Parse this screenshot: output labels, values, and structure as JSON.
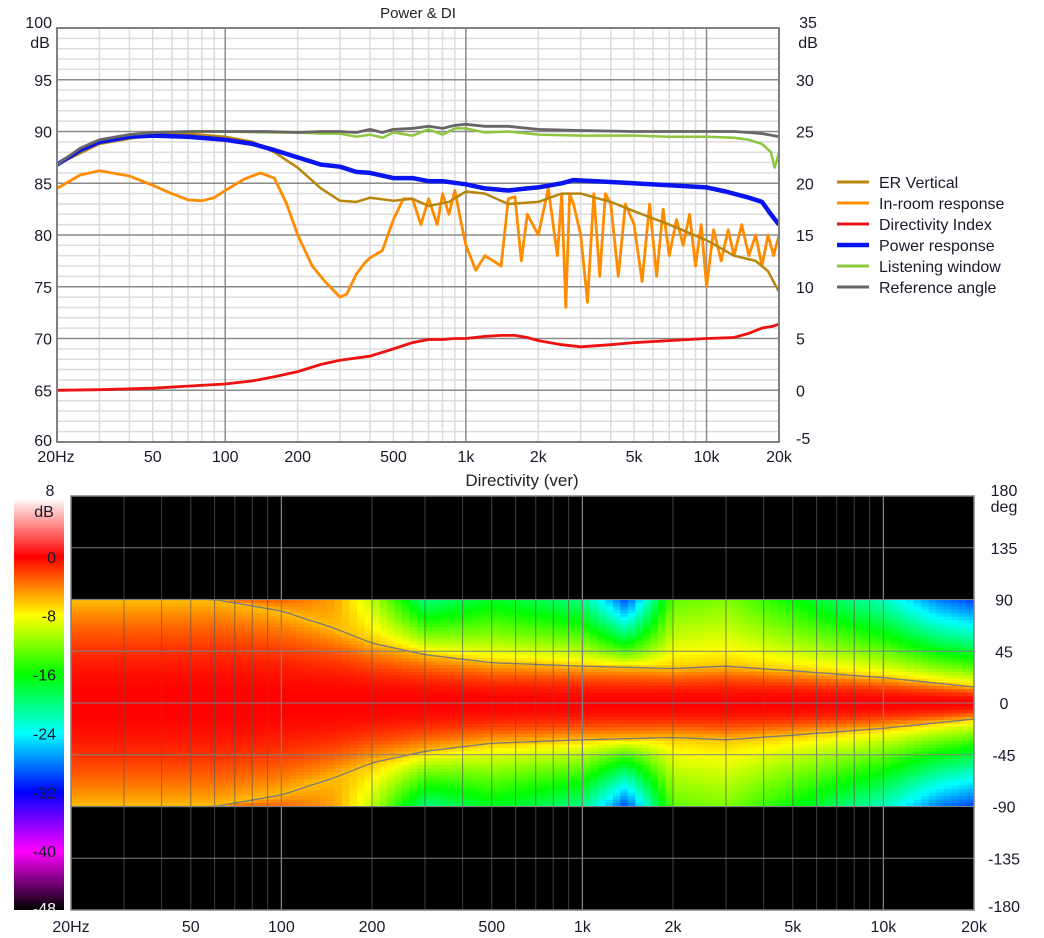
{
  "chart_data": [
    {
      "type": "line",
      "title": "Power & DI",
      "xlabel": "",
      "x_scale": "log",
      "xlim": [
        20,
        20000
      ],
      "x_ticks": [
        {
          "value": 20,
          "label": "20Hz"
        },
        {
          "value": 50,
          "label": "50"
        },
        {
          "value": 100,
          "label": "100"
        },
        {
          "value": 200,
          "label": "200"
        },
        {
          "value": 500,
          "label": "500"
        },
        {
          "value": 1000,
          "label": "1k"
        },
        {
          "value": 2000,
          "label": "2k"
        },
        {
          "value": 5000,
          "label": "5k"
        },
        {
          "value": 10000,
          "label": "10k"
        },
        {
          "value": 20000,
          "label": "20k"
        }
      ],
      "ylabel_left_unit": "dB",
      "ylim_left": [
        60,
        100
      ],
      "y_ticks_left": [
        60,
        65,
        70,
        75,
        80,
        85,
        90,
        95,
        100
      ],
      "ylabel_right_unit": "dB",
      "ylim_right": [
        -5,
        35
      ],
      "y_ticks_right": [
        -5,
        0,
        5,
        10,
        15,
        20,
        25,
        30,
        35
      ],
      "grid": true,
      "legend_position": "right",
      "series": [
        {
          "name": "ER Vertical",
          "color": "#b8860b",
          "axis": "left",
          "x": [
            20,
            30,
            50,
            70,
            100,
            130,
            160,
            200,
            250,
            300,
            350,
            400,
            500,
            600,
            700,
            850,
            1000,
            1200,
            1500,
            2000,
            2500,
            3000,
            4000,
            5000,
            7000,
            10000,
            13000,
            16000,
            18000,
            20000
          ],
          "y": [
            86.8,
            88.8,
            89.7,
            89.8,
            89.5,
            89,
            88,
            86.5,
            84.5,
            83.3,
            83.2,
            83.6,
            83.3,
            83.5,
            82.8,
            83.2,
            84.2,
            84,
            83,
            83.2,
            84,
            84,
            83.2,
            82.3,
            81,
            79.5,
            78,
            77.5,
            76.5,
            74.5
          ]
        },
        {
          "name": "In-room response",
          "color": "#ff8c00",
          "axis": "left",
          "x": [
            20,
            25,
            30,
            40,
            50,
            60,
            70,
            80,
            90,
            100,
            120,
            140,
            160,
            180,
            200,
            230,
            260,
            300,
            320,
            350,
            380,
            400,
            450,
            500,
            550,
            600,
            650,
            700,
            760,
            800,
            850,
            900,
            950,
            1000,
            1100,
            1200,
            1300,
            1400,
            1500,
            1600,
            1700,
            1800,
            2000,
            2200,
            2400,
            2500,
            2600,
            2700,
            2800,
            3000,
            3200,
            3400,
            3600,
            3800,
            4000,
            4300,
            4600,
            5000,
            5400,
            5800,
            6200,
            6600,
            7000,
            7500,
            8000,
            8500,
            9000,
            9500,
            10000,
            10700,
            11500,
            12300,
            13000,
            14000,
            15000,
            16000,
            17000,
            18000,
            19000,
            20000
          ],
          "y": [
            84.5,
            85.8,
            86.2,
            85.7,
            84.8,
            84,
            83.4,
            83.3,
            83.6,
            84.3,
            85.4,
            86,
            85.5,
            83,
            80,
            77,
            75.5,
            74,
            74.3,
            76.2,
            77.3,
            77.8,
            78.5,
            81.5,
            83.5,
            83.5,
            81,
            83.5,
            81,
            84,
            82,
            84.3,
            81.5,
            79,
            76.6,
            78,
            77.5,
            77,
            83.5,
            83.7,
            77.5,
            82,
            80,
            84.5,
            78,
            84,
            73,
            84,
            83,
            80,
            73.5,
            84,
            76,
            84,
            83,
            76,
            83,
            81,
            75.5,
            83,
            76,
            82.5,
            78,
            81.5,
            79,
            82,
            77,
            81,
            75,
            80.5,
            77.5,
            80.5,
            78,
            81,
            78,
            80,
            77,
            80,
            78,
            80
          ]
        },
        {
          "name": "Directivity Index",
          "color": "#ee1111",
          "axis": "right",
          "x": [
            20,
            30,
            50,
            70,
            100,
            130,
            160,
            200,
            250,
            300,
            400,
            500,
            600,
            700,
            800,
            900,
            1000,
            1200,
            1400,
            1600,
            1800,
            2000,
            2500,
            3000,
            4000,
            5000,
            7000,
            10000,
            13000,
            15000,
            17000,
            19000,
            20000
          ],
          "y": [
            0,
            0.05,
            0.2,
            0.4,
            0.6,
            0.9,
            1.3,
            1.8,
            2.5,
            2.9,
            3.3,
            4,
            4.6,
            4.9,
            4.9,
            5,
            5,
            5.2,
            5.3,
            5.3,
            5.1,
            4.8,
            4.4,
            4.2,
            4.4,
            4.6,
            4.8,
            5,
            5.1,
            5.5,
            6,
            6.2,
            6.4
          ]
        },
        {
          "name": "Power response",
          "color": "#0a14f0",
          "axis": "left",
          "x": [
            20,
            25,
            30,
            40,
            50,
            70,
            100,
            130,
            160,
            200,
            250,
            300,
            350,
            400,
            500,
            600,
            700,
            800,
            1000,
            1200,
            1500,
            1800,
            2000,
            2500,
            2800,
            3500,
            5000,
            7000,
            10000,
            12000,
            15000,
            17000,
            18500,
            20000
          ],
          "y": [
            86.8,
            88.2,
            89,
            89.5,
            89.6,
            89.5,
            89.2,
            88.8,
            88.2,
            87.5,
            86.8,
            86.6,
            86.1,
            86,
            85.5,
            85.5,
            85.2,
            85.2,
            84.9,
            84.5,
            84.3,
            84.5,
            84.6,
            85,
            85.3,
            85.2,
            85,
            84.8,
            84.6,
            84.2,
            83.6,
            83.2,
            82,
            81
          ]
        },
        {
          "name": "Listening window",
          "color": "#8dc63f",
          "axis": "left",
          "x": [
            20,
            25,
            30,
            40,
            50,
            70,
            100,
            150,
            200,
            250,
            300,
            350,
            400,
            450,
            500,
            600,
            700,
            800,
            900,
            1000,
            1200,
            1500,
            2000,
            3000,
            5000,
            7000,
            10000,
            13000,
            15000,
            17000,
            18500,
            19200,
            20000
          ],
          "y": [
            86.8,
            88.4,
            89.2,
            89.7,
            89.9,
            90,
            90,
            89.9,
            89.9,
            89.8,
            89.8,
            89.5,
            89.7,
            89.4,
            89.9,
            89.6,
            90.2,
            89.7,
            90.3,
            90.3,
            89.9,
            90,
            89.7,
            89.6,
            89.6,
            89.5,
            89.5,
            89.4,
            89.2,
            88.8,
            88,
            86.5,
            88
          ]
        },
        {
          "name": "Reference angle",
          "color": "#666666",
          "axis": "left",
          "x": [
            20,
            25,
            30,
            40,
            50,
            70,
            100,
            150,
            200,
            250,
            300,
            350,
            400,
            450,
            500,
            600,
            700,
            800,
            900,
            1000,
            1200,
            1500,
            2000,
            3000,
            5000,
            7000,
            10000,
            13000,
            15000,
            17000,
            19000,
            20000
          ],
          "y": [
            86.8,
            88.4,
            89.2,
            89.7,
            89.9,
            90,
            90,
            90,
            89.9,
            90,
            90,
            89.9,
            90.2,
            89.9,
            90.2,
            90.3,
            90.5,
            90.3,
            90.6,
            90.7,
            90.5,
            90.5,
            90.2,
            90.1,
            90,
            90,
            90,
            90,
            89.9,
            89.8,
            89.6,
            89.5
          ]
        }
      ]
    },
    {
      "type": "heatmap",
      "title": "Directivity (ver)",
      "x_scale": "log",
      "xlim": [
        20,
        20000
      ],
      "x_ticks": [
        {
          "value": 20,
          "label": "20Hz"
        },
        {
          "value": 50,
          "label": "50"
        },
        {
          "value": 100,
          "label": "100"
        },
        {
          "value": 200,
          "label": "200"
        },
        {
          "value": 500,
          "label": "500"
        },
        {
          "value": 1000,
          "label": "1k"
        },
        {
          "value": 2000,
          "label": "2k"
        },
        {
          "value": 5000,
          "label": "5k"
        },
        {
          "value": 10000,
          "label": "10k"
        },
        {
          "value": 20000,
          "label": "20k"
        }
      ],
      "ylabel_unit": "deg",
      "ylim": [
        -180,
        180
      ],
      "y_ticks": [
        -180,
        -135,
        -90,
        -45,
        0,
        45,
        90,
        135,
        180
      ],
      "data_angle_range": [
        -90,
        90
      ],
      "colorbar": {
        "unit": "dB",
        "range": [
          -48,
          8
        ],
        "ticks": [
          8,
          0,
          -8,
          -16,
          -24,
          -32,
          -40,
          -48
        ],
        "stops": [
          {
            "value": 8,
            "color": "#ffffff"
          },
          {
            "value": 0,
            "color": "#ff0000"
          },
          {
            "value": -8,
            "color": "#ffff00"
          },
          {
            "value": -16,
            "color": "#00ff00"
          },
          {
            "value": -24,
            "color": "#00ffff"
          },
          {
            "value": -32,
            "color": "#0000ff"
          },
          {
            "value": -40,
            "color": "#ff00ff"
          },
          {
            "value": -48,
            "color": "#000000"
          }
        ]
      },
      "beamwidth_6dB_half_angle_deg": {
        "freq": [
          20,
          60,
          100,
          150,
          200,
          300,
          500,
          1000,
          2000,
          3000,
          5000,
          10000,
          20000
        ],
        "angle": [
          90,
          90,
          80,
          65,
          52,
          42,
          35,
          32,
          30,
          32,
          28,
          22,
          14
        ]
      },
      "edge_level_db_at_90deg": {
        "freq": [
          20,
          100,
          150,
          200,
          300,
          500,
          1000,
          1400,
          2000,
          3000,
          5000,
          10000,
          15000,
          20000
        ],
        "level": [
          -2,
          -3,
          -5,
          -10,
          -20,
          -17,
          -20,
          -30,
          -13,
          -12,
          -16,
          -22,
          -28,
          -30
        ]
      }
    }
  ]
}
